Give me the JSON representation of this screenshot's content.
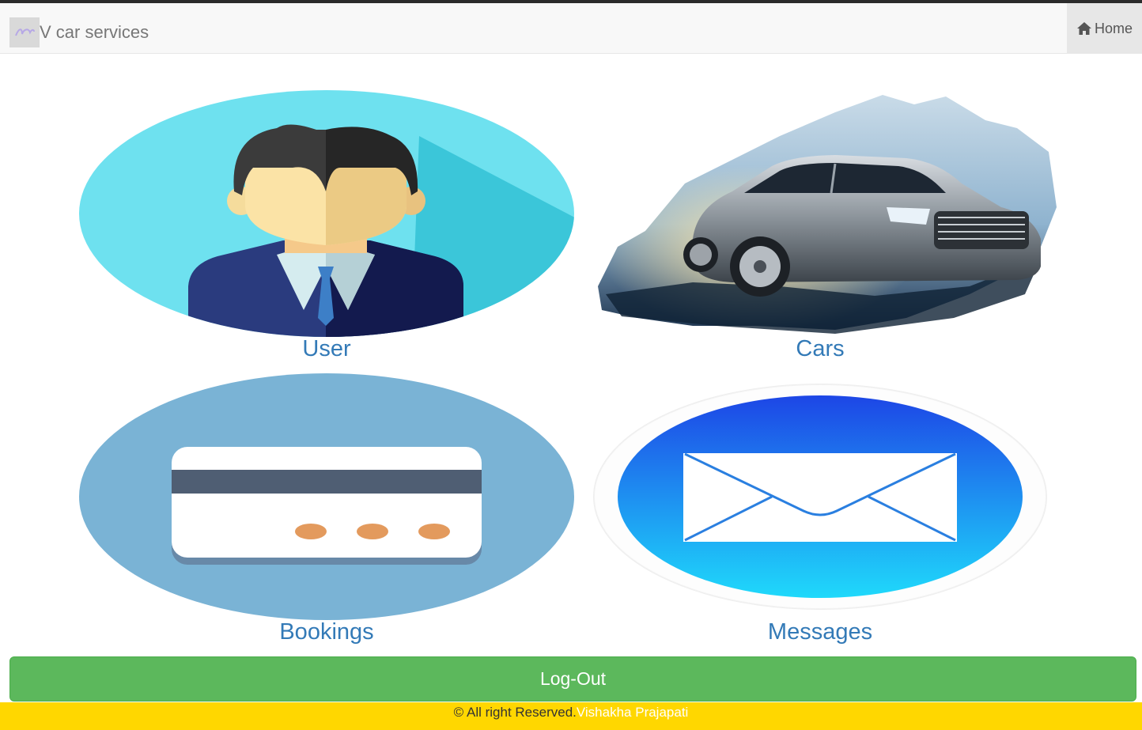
{
  "nav": {
    "brand": "V car services",
    "home_label": "Home"
  },
  "tiles": [
    {
      "label": "User"
    },
    {
      "label": "Cars"
    },
    {
      "label": "Bookings"
    },
    {
      "label": "Messages"
    }
  ],
  "logout_label": "Log-Out",
  "footer": {
    "text": "© All right Reserved.",
    "author": "Vishakha Prajapati"
  },
  "colors": {
    "navbar_bg": "#f8f8f8",
    "link": "#337ab7",
    "logout_bg": "#5cb85c",
    "footer_bg": "#ffd700",
    "footer_author": "#ffffff"
  },
  "icons": [
    "home-icon",
    "user-avatar-icon",
    "car-image",
    "credit-card-icon",
    "envelope-icon"
  ]
}
